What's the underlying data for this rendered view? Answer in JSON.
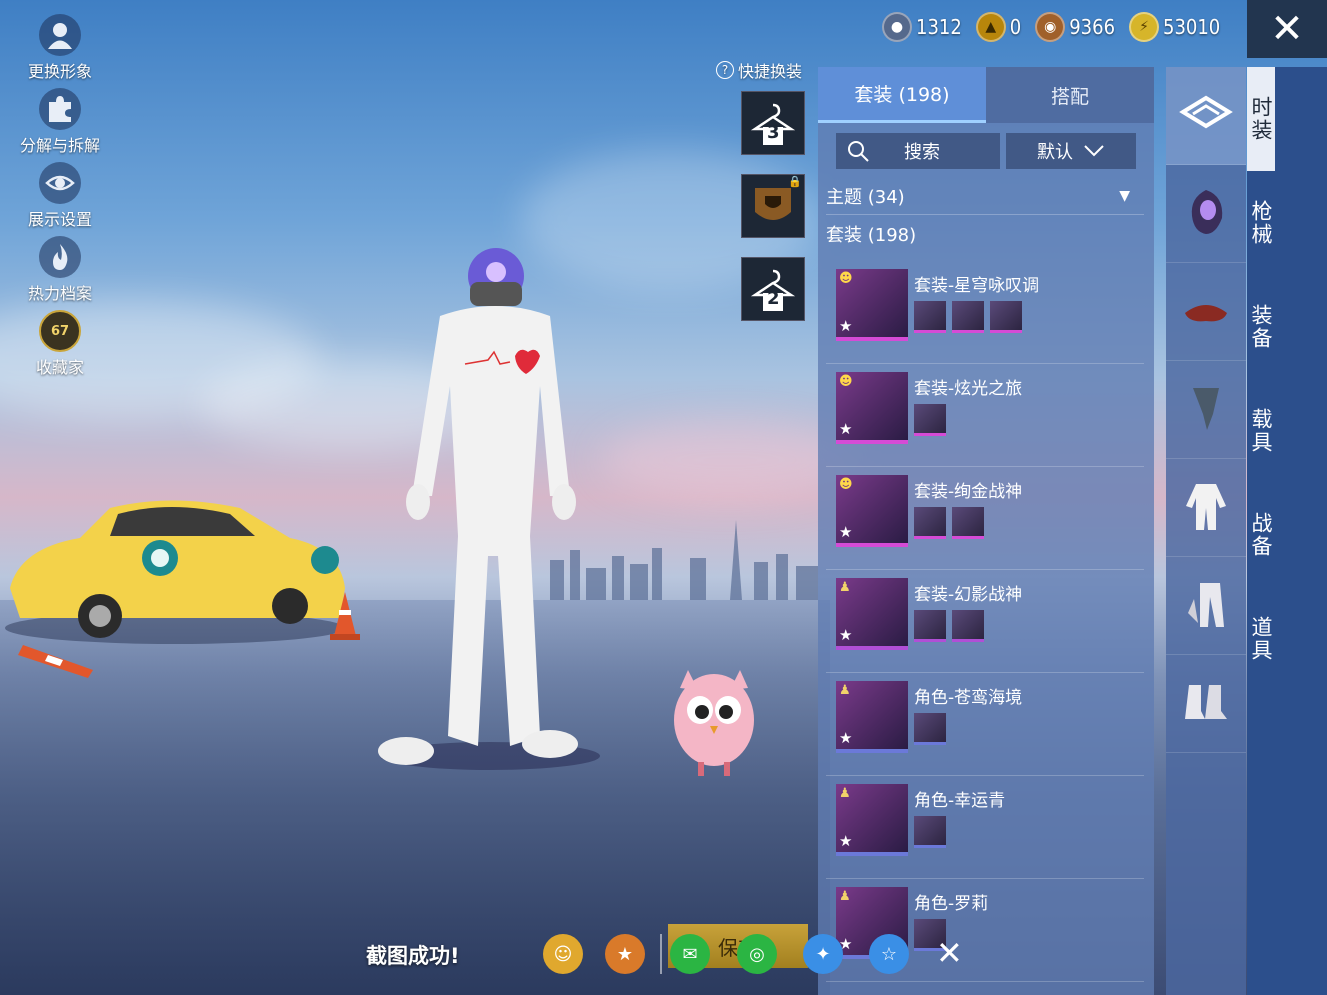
{
  "left_menu": [
    {
      "label": "更换形象",
      "icon": "avatar-icon"
    },
    {
      "label": "分解与拆解",
      "icon": "puzzle-icon"
    },
    {
      "label": "展示设置",
      "icon": "eye-icon"
    },
    {
      "label": "热力档案",
      "icon": "flame-icon"
    },
    {
      "label": "收藏家",
      "icon": "collector-badge-icon",
      "badge": "67"
    }
  ],
  "currency": [
    {
      "value": "1312",
      "icon": "globe-coin-icon",
      "color": "#8fa6c8"
    },
    {
      "value": "0",
      "icon": "gold-token-icon",
      "color": "#d6a521"
    },
    {
      "value": "9366",
      "icon": "bronze-coin-icon",
      "color": "#b8702d"
    },
    {
      "value": "53010",
      "icon": "bolt-coin-icon",
      "color": "#e2c43a"
    }
  ],
  "quick_swap": {
    "label": "快捷换装",
    "presets": [
      "3",
      "",
      "2"
    ]
  },
  "panel": {
    "tabs": [
      {
        "label": "套装 (198)",
        "active": true
      },
      {
        "label": "搭配",
        "active": false
      }
    ],
    "search_label": "搜索",
    "sort_label": "默认",
    "theme_label": "主题 (34)",
    "set_header": "套装 (198)",
    "items": [
      {
        "title": "套装-星穹咏叹调",
        "rarity_color": "#d54bd6",
        "sub_count": 3,
        "smile": true
      },
      {
        "title": "套装-炫光之旅",
        "rarity_color": "#d54bd6",
        "sub_count": 1,
        "smile": true
      },
      {
        "title": "套装-绚金战神",
        "rarity_color": "#d54bd6",
        "sub_count": 2,
        "smile": true
      },
      {
        "title": "套装-幻影战神",
        "rarity_color": "#b04fd6",
        "sub_count": 2,
        "smile": false
      },
      {
        "title": "角色-苍鸾海境",
        "rarity_color": "#6b79d9",
        "sub_count": 1,
        "smile": false
      },
      {
        "title": "角色-幸运青",
        "rarity_color": "#6b79d9",
        "sub_count": 1,
        "smile": false
      },
      {
        "title": "角色-罗莉",
        "rarity_color": "#6b79d9",
        "sub_count": 1,
        "smile": false
      }
    ]
  },
  "categories": [
    "outfit-box-icon",
    "helmet-icon",
    "hat-icon",
    "mask-icon",
    "suit-icon",
    "pants-icon",
    "boots-icon"
  ],
  "nav": [
    {
      "label": "时装",
      "active": true
    },
    {
      "label": "枪械",
      "active": false
    },
    {
      "label": "装备",
      "active": false
    },
    {
      "label": "载具",
      "active": false
    },
    {
      "label": "战备",
      "active": false
    },
    {
      "label": "道具",
      "active": false
    }
  ],
  "bottom": {
    "toast": "截图成功!",
    "save_label": "保存",
    "share": [
      {
        "icon": "game-friends-icon",
        "color": "#e0a82e"
      },
      {
        "icon": "peace-elite-icon",
        "color": "#d97a2a"
      },
      {
        "icon": "wechat-icon",
        "color": "#2bb543"
      },
      {
        "icon": "moments-icon",
        "color": "#2bb543"
      },
      {
        "icon": "qq-icon",
        "color": "#3a8fe6"
      },
      {
        "icon": "qzone-icon",
        "color": "#3a8fe6"
      }
    ]
  }
}
